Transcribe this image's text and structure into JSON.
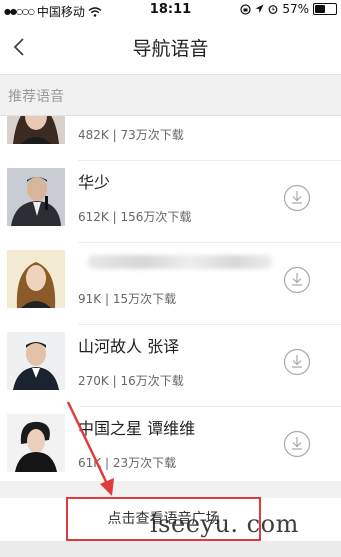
{
  "status_bar": {
    "carrier": "中国移动",
    "time": "18:11",
    "battery_text": "57%",
    "battery_level": 0.57
  },
  "nav": {
    "title": "导航语音"
  },
  "section": {
    "title": "推荐语音"
  },
  "voices": [
    {
      "name": "",
      "size": "482K",
      "downloads": "73万次下载"
    },
    {
      "name": "华少",
      "size": "612K",
      "downloads": "156万次下载"
    },
    {
      "name": "",
      "size": "91K",
      "downloads": "15万次下载"
    },
    {
      "name": "山河故人 张译",
      "size": "270K",
      "downloads": "16万次下载"
    },
    {
      "name": "中国之星 谭维维",
      "size": "61K",
      "downloads": "23万次下载"
    }
  ],
  "meta_sep": " | ",
  "cta": {
    "label": "点击查看语音广场"
  },
  "watermark": "iseeyu. com",
  "colors": {
    "accent_red": "#e03a3a",
    "section_bg": "#f1f1f1"
  }
}
